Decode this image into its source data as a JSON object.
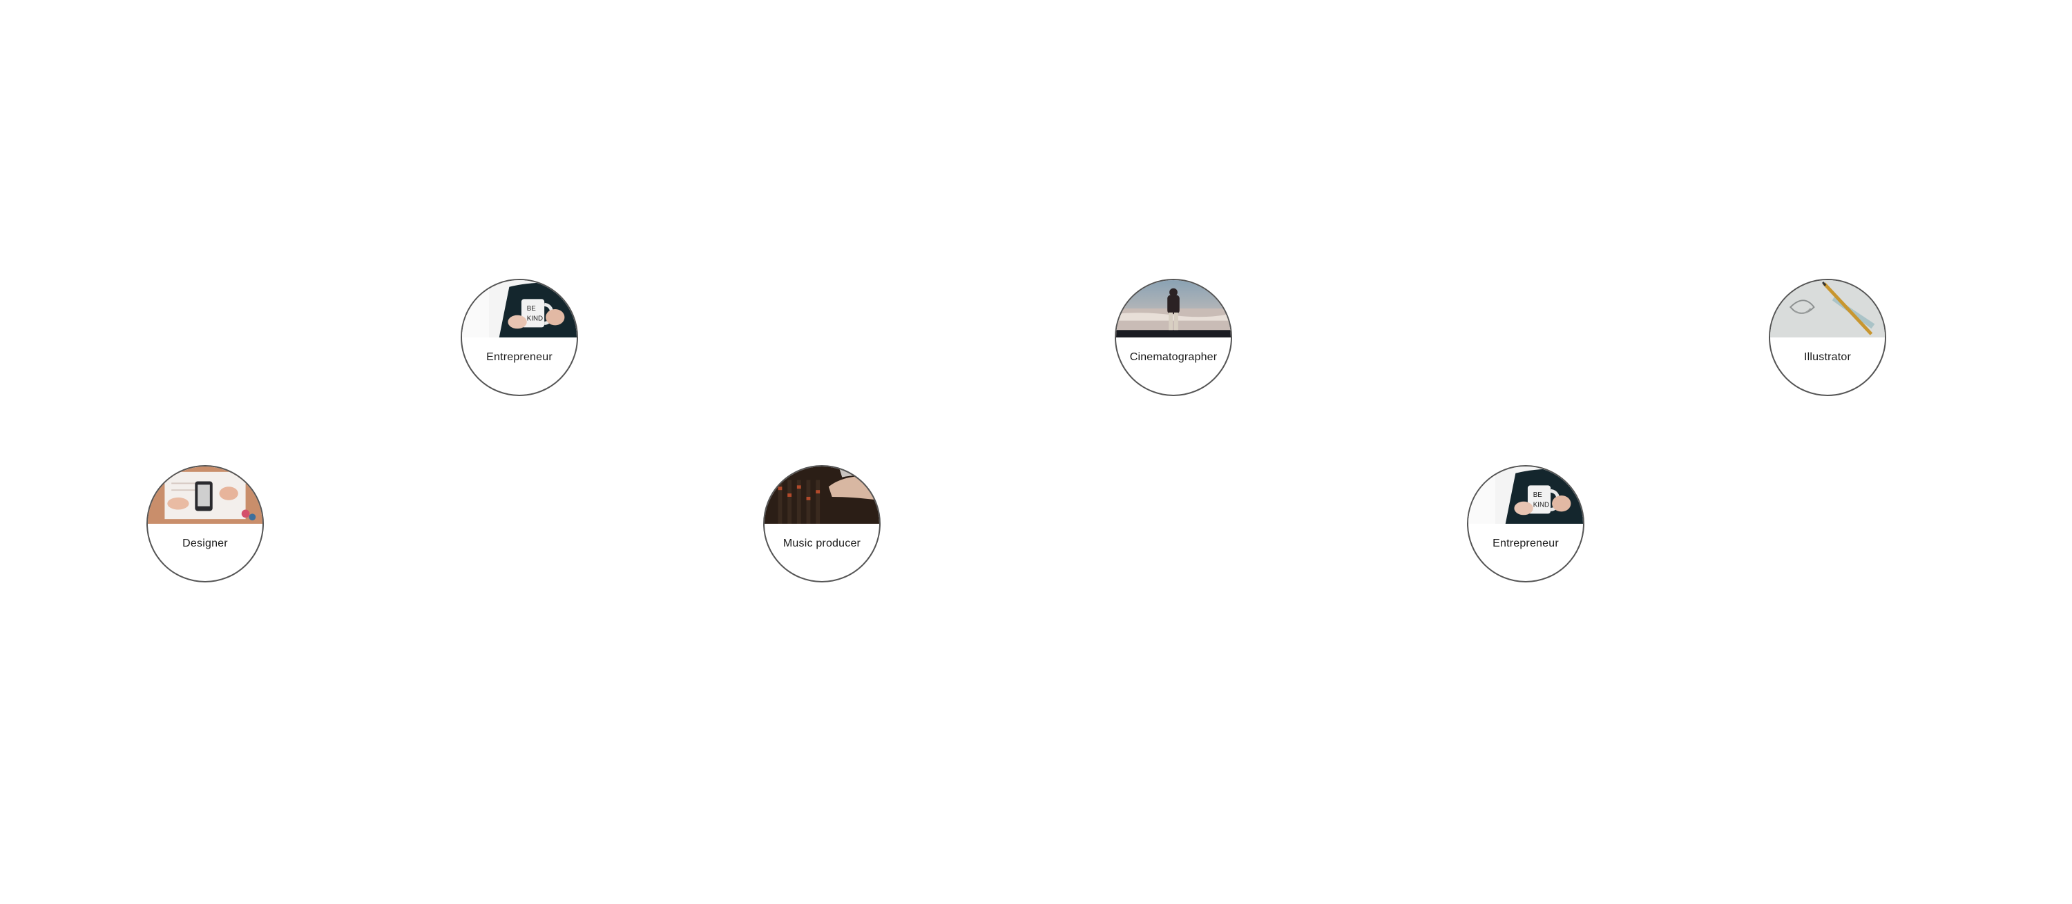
{
  "roles": [
    {
      "label": "Entrepreneur",
      "photo": "coffee-mug-photo"
    },
    {
      "label": "Cinematographer",
      "photo": "person-at-beach-photo"
    },
    {
      "label": "Illustrator",
      "photo": "sketch-and-pencil-photo"
    },
    {
      "label": "Designer",
      "photo": "desk-with-phone-photo"
    },
    {
      "label": "Music producer",
      "photo": "mixing-console-photo"
    },
    {
      "label": "Entrepreneur",
      "photo": "coffee-mug-photo"
    }
  ]
}
